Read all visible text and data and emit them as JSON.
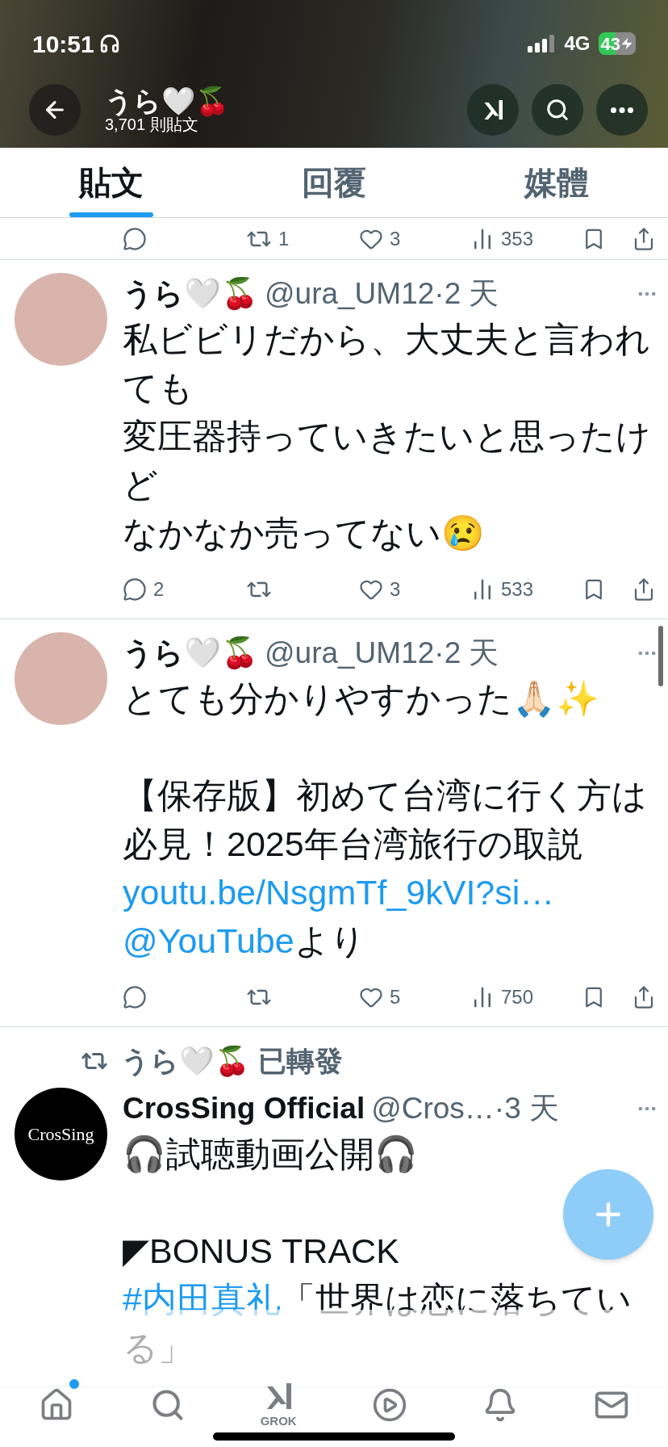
{
  "status_bar": {
    "time": "10:51",
    "network": "4G",
    "battery": "43"
  },
  "header": {
    "name": "うら🤍🍒",
    "post_count": "3,701 則貼文"
  },
  "tabs": [
    {
      "label": "貼文",
      "selected": true
    },
    {
      "label": "回覆",
      "selected": false
    },
    {
      "label": "媒體",
      "selected": false
    }
  ],
  "partial_actions": {
    "retweets": "1",
    "likes": "3",
    "views": "353"
  },
  "posts": [
    {
      "kind": "post",
      "name": "うら🤍🍒",
      "meta": "@ura_UM12·2 天",
      "paragraphs": [
        [
          [
            {
              "kind": "text",
              "text": "私ビビリだから、大丈夫と言われても"
            }
          ],
          [
            {
              "kind": "text",
              "text": "変圧器持っていきたいと思ったけど"
            }
          ],
          [
            {
              "kind": "text",
              "text": "なかなか売ってない😢"
            }
          ]
        ]
      ],
      "actions": {
        "replies": "2",
        "likes": "3",
        "views": "533"
      }
    },
    {
      "kind": "post",
      "name": "うら🤍🍒",
      "meta": "@ura_UM12·2 天",
      "paragraphs": [
        [
          [
            {
              "kind": "text",
              "text": "とても分かりやすかった🙏🏻✨"
            }
          ]
        ],
        [
          [
            {
              "kind": "text",
              "text": "【保存版】初めて台湾に行く方は必見！2025年台湾旅行の取説"
            }
          ],
          [
            {
              "kind": "link",
              "text": "youtu.be/NsgmTf_9kVI?si…"
            }
          ],
          [
            {
              "kind": "link",
              "text": "@YouTube"
            },
            {
              "kind": "text",
              "text": "より"
            }
          ]
        ]
      ],
      "actions": {
        "likes": "5",
        "views": "750"
      }
    },
    {
      "kind": "repost",
      "reposted_by": "うら🤍🍒 已轉發",
      "avatar_text": "CrosSing",
      "name": "CrosSing Official",
      "meta": "@Cros…·3 天",
      "paragraphs": [
        [
          [
            {
              "kind": "text",
              "text": "🎧試聴動画公開🎧"
            }
          ]
        ],
        [
          [
            {
              "kind": "text",
              "text": "◤BONUS TRACK"
            }
          ],
          [
            {
              "kind": "link",
              "text": "#内田真礼"
            },
            {
              "kind": "text",
              "text": "「世界は恋に落ちている」"
            }
          ]
        ]
      ]
    }
  ],
  "nav": [
    {
      "kind": "home",
      "unread": true
    },
    {
      "kind": "search",
      "unread": false
    },
    {
      "kind": "grok",
      "label": "GROK",
      "unread": false
    },
    {
      "kind": "video",
      "unread": false
    },
    {
      "kind": "notifications",
      "unread": false
    },
    {
      "kind": "messages",
      "unread": false
    }
  ]
}
